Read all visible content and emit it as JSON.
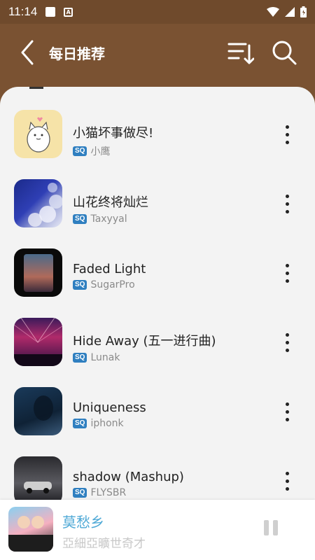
{
  "status_bar": {
    "time": "11:14",
    "icons": [
      "notification-square-icon",
      "a-box-icon",
      "wifi-icon",
      "signal-icon",
      "battery-icon"
    ]
  },
  "header": {
    "title": "每日推荐",
    "back_icon": "back-chevron-icon",
    "actions": [
      "sort-list-icon",
      "search-icon"
    ],
    "background": "#7a5232"
  },
  "songs": [
    {
      "title": "小猫坏事做尽!",
      "quality": "SQ",
      "artist": "小鹰"
    },
    {
      "title": "山花终将灿烂",
      "quality": "SQ",
      "artist": "Taxyyal"
    },
    {
      "title": "Faded Light",
      "quality": "SQ",
      "artist": "SugarPro"
    },
    {
      "title": "Hide Away (五一进行曲)",
      "quality": "SQ",
      "artist": "Lunak"
    },
    {
      "title": "Uniqueness",
      "quality": "SQ",
      "artist": "iphonk"
    },
    {
      "title": "shadow (Mashup)",
      "quality": "SQ",
      "artist": "FLYSBR"
    }
  ],
  "now_playing": {
    "title": "莫愁乡",
    "artist": "亞細亞曠世奇才",
    "state": "playing",
    "title_color": "#4fa9d6"
  },
  "colors": {
    "quality_badge": "#2f7fc0",
    "sheet_bg": "#f3f3f3"
  }
}
